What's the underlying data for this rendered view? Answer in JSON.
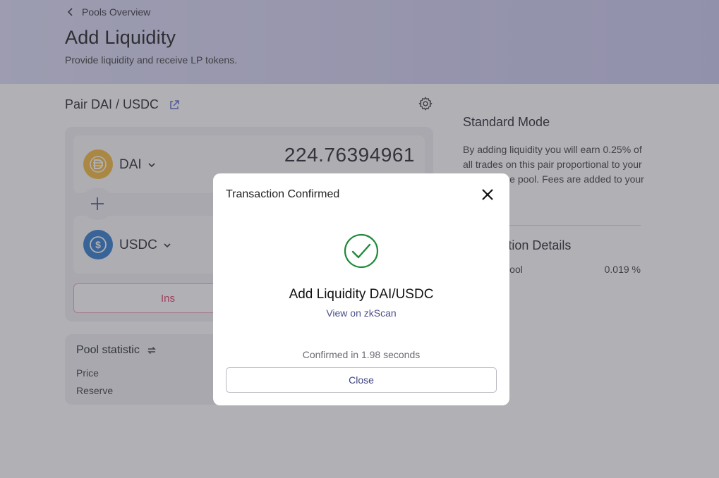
{
  "header": {
    "back_label": "Pools Overview",
    "title": "Add Liquidity",
    "subtitle": "Provide liquidity and receive LP tokens."
  },
  "pair": {
    "label": "Pair DAI / USDC"
  },
  "tokens": [
    {
      "symbol": "DAI",
      "amount": "224.76394961",
      "color": "#f4b731"
    },
    {
      "symbol": "USDC",
      "amount": "",
      "color": "#2775ca"
    }
  ],
  "action_button_partial": "Ins",
  "stats": {
    "title": "Pool statistic",
    "rows": [
      {
        "label": "Price"
      },
      {
        "label": "Reserve"
      }
    ]
  },
  "side": {
    "title": "Standard Mode",
    "text": "By adding liquidity you will earn 0.25% of all trades on this pair proportional to your share of the pool. Fees are added to your principal in",
    "details_title": "Transaction Details",
    "share_label": "Share of Pool",
    "share_value": "0.019 %"
  },
  "modal": {
    "title": "Transaction Confirmed",
    "heading": "Add Liquidity DAI/USDC",
    "link": "View on zkScan",
    "status": "Confirmed in 1.98 seconds",
    "close_label": "Close",
    "success_color": "#1f8a3b"
  }
}
